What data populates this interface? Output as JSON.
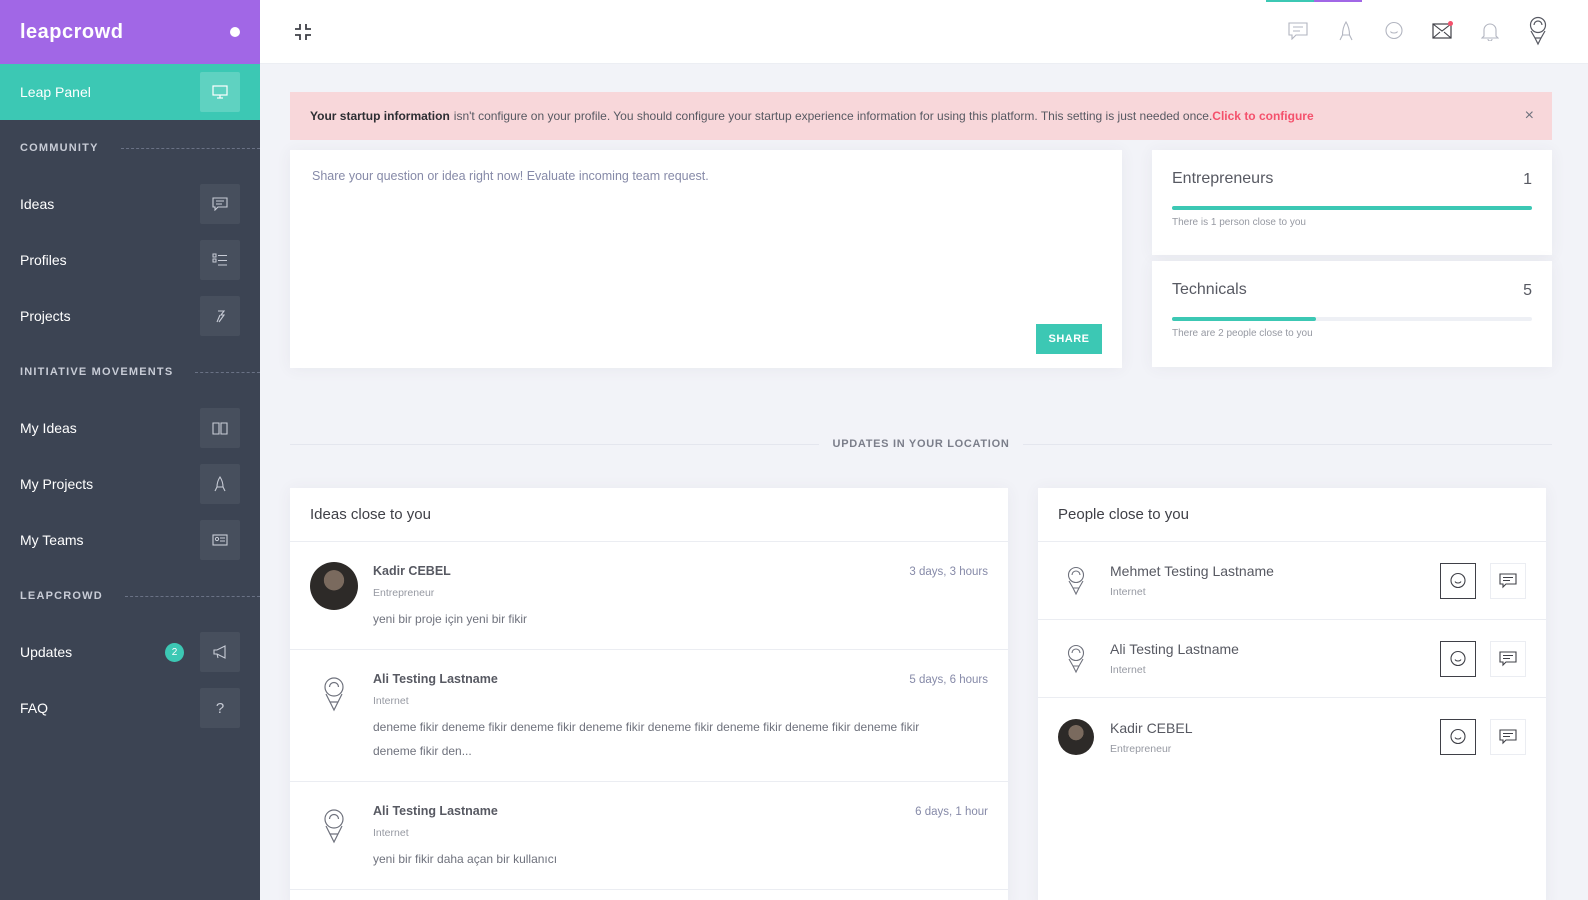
{
  "brand": {
    "logo": "leapcrowd"
  },
  "sidebar": {
    "panel": {
      "label": "Leap Panel"
    },
    "sections": [
      {
        "label": "COMMUNITY",
        "items": [
          {
            "label": "Ideas",
            "icon": "chat-icon"
          },
          {
            "label": "Profiles",
            "icon": "list-icon"
          },
          {
            "label": "Projects",
            "icon": "pin-icon"
          }
        ]
      },
      {
        "label": "INITIATIVE MOVEMENTS",
        "items": [
          {
            "label": "My Ideas",
            "icon": "book-icon"
          },
          {
            "label": "My Projects",
            "icon": "rocket-icon"
          },
          {
            "label": "My Teams",
            "icon": "id-card-icon"
          }
        ]
      },
      {
        "label": "LEAPCROWD",
        "items": [
          {
            "label": "Updates",
            "icon": "megaphone-icon",
            "badge": "2"
          },
          {
            "label": "FAQ",
            "icon": "question-icon"
          }
        ]
      }
    ]
  },
  "alert": {
    "strong": "Your startup information",
    "text": "isn't configure on your profile. You should configure your startup experience information for using this platform. This setting is just needed once.",
    "cta": "Click to configure",
    "close": "×"
  },
  "share": {
    "placeholder": "Share your question or idea right now! Evaluate incoming team request.",
    "button": "SHARE"
  },
  "stats": [
    {
      "title": "Entrepreneurs",
      "count": "1",
      "sub": "There is 1 person close to you",
      "progress": 1.0
    },
    {
      "title": "Technicals",
      "count": "5",
      "sub": "There are 2 people close to you",
      "progress": 0.4
    }
  ],
  "updates_label": "UPDATES IN YOUR LOCATION",
  "ideas": {
    "title": "Ideas close to you",
    "items": [
      {
        "name": "Kadir CEBEL",
        "role": "Entrepreneur",
        "text": "yeni bir proje için yeni bir fikir",
        "time": "3 days, 3 hours",
        "photo": true
      },
      {
        "name": "Ali Testing Lastname",
        "role": "Internet",
        "text": "deneme fikir deneme fikir deneme fikir deneme fikir deneme fikir deneme fikir deneme fikir deneme fikir deneme fikir den...",
        "time": "5 days, 6 hours",
        "photo": false
      },
      {
        "name": "Ali Testing Lastname",
        "role": "Internet",
        "text": "yeni bir fikir daha açan bir kullanıcı",
        "time": "6 days, 1 hour",
        "photo": false
      }
    ]
  },
  "people": {
    "title": "People close to you",
    "items": [
      {
        "name": "Mehmet Testing Lastname",
        "role": "Internet",
        "photo": false
      },
      {
        "name": "Ali Testing Lastname",
        "role": "Internet",
        "photo": false
      },
      {
        "name": "Kadir CEBEL",
        "role": "Entrepreneur",
        "photo": true
      }
    ]
  },
  "colors": {
    "accent": "#3cc8b4",
    "brand": "#a167e6",
    "sidebar": "#3c4453",
    "alert_bg": "#f8d7da",
    "alert_cta": "#f4516c"
  }
}
